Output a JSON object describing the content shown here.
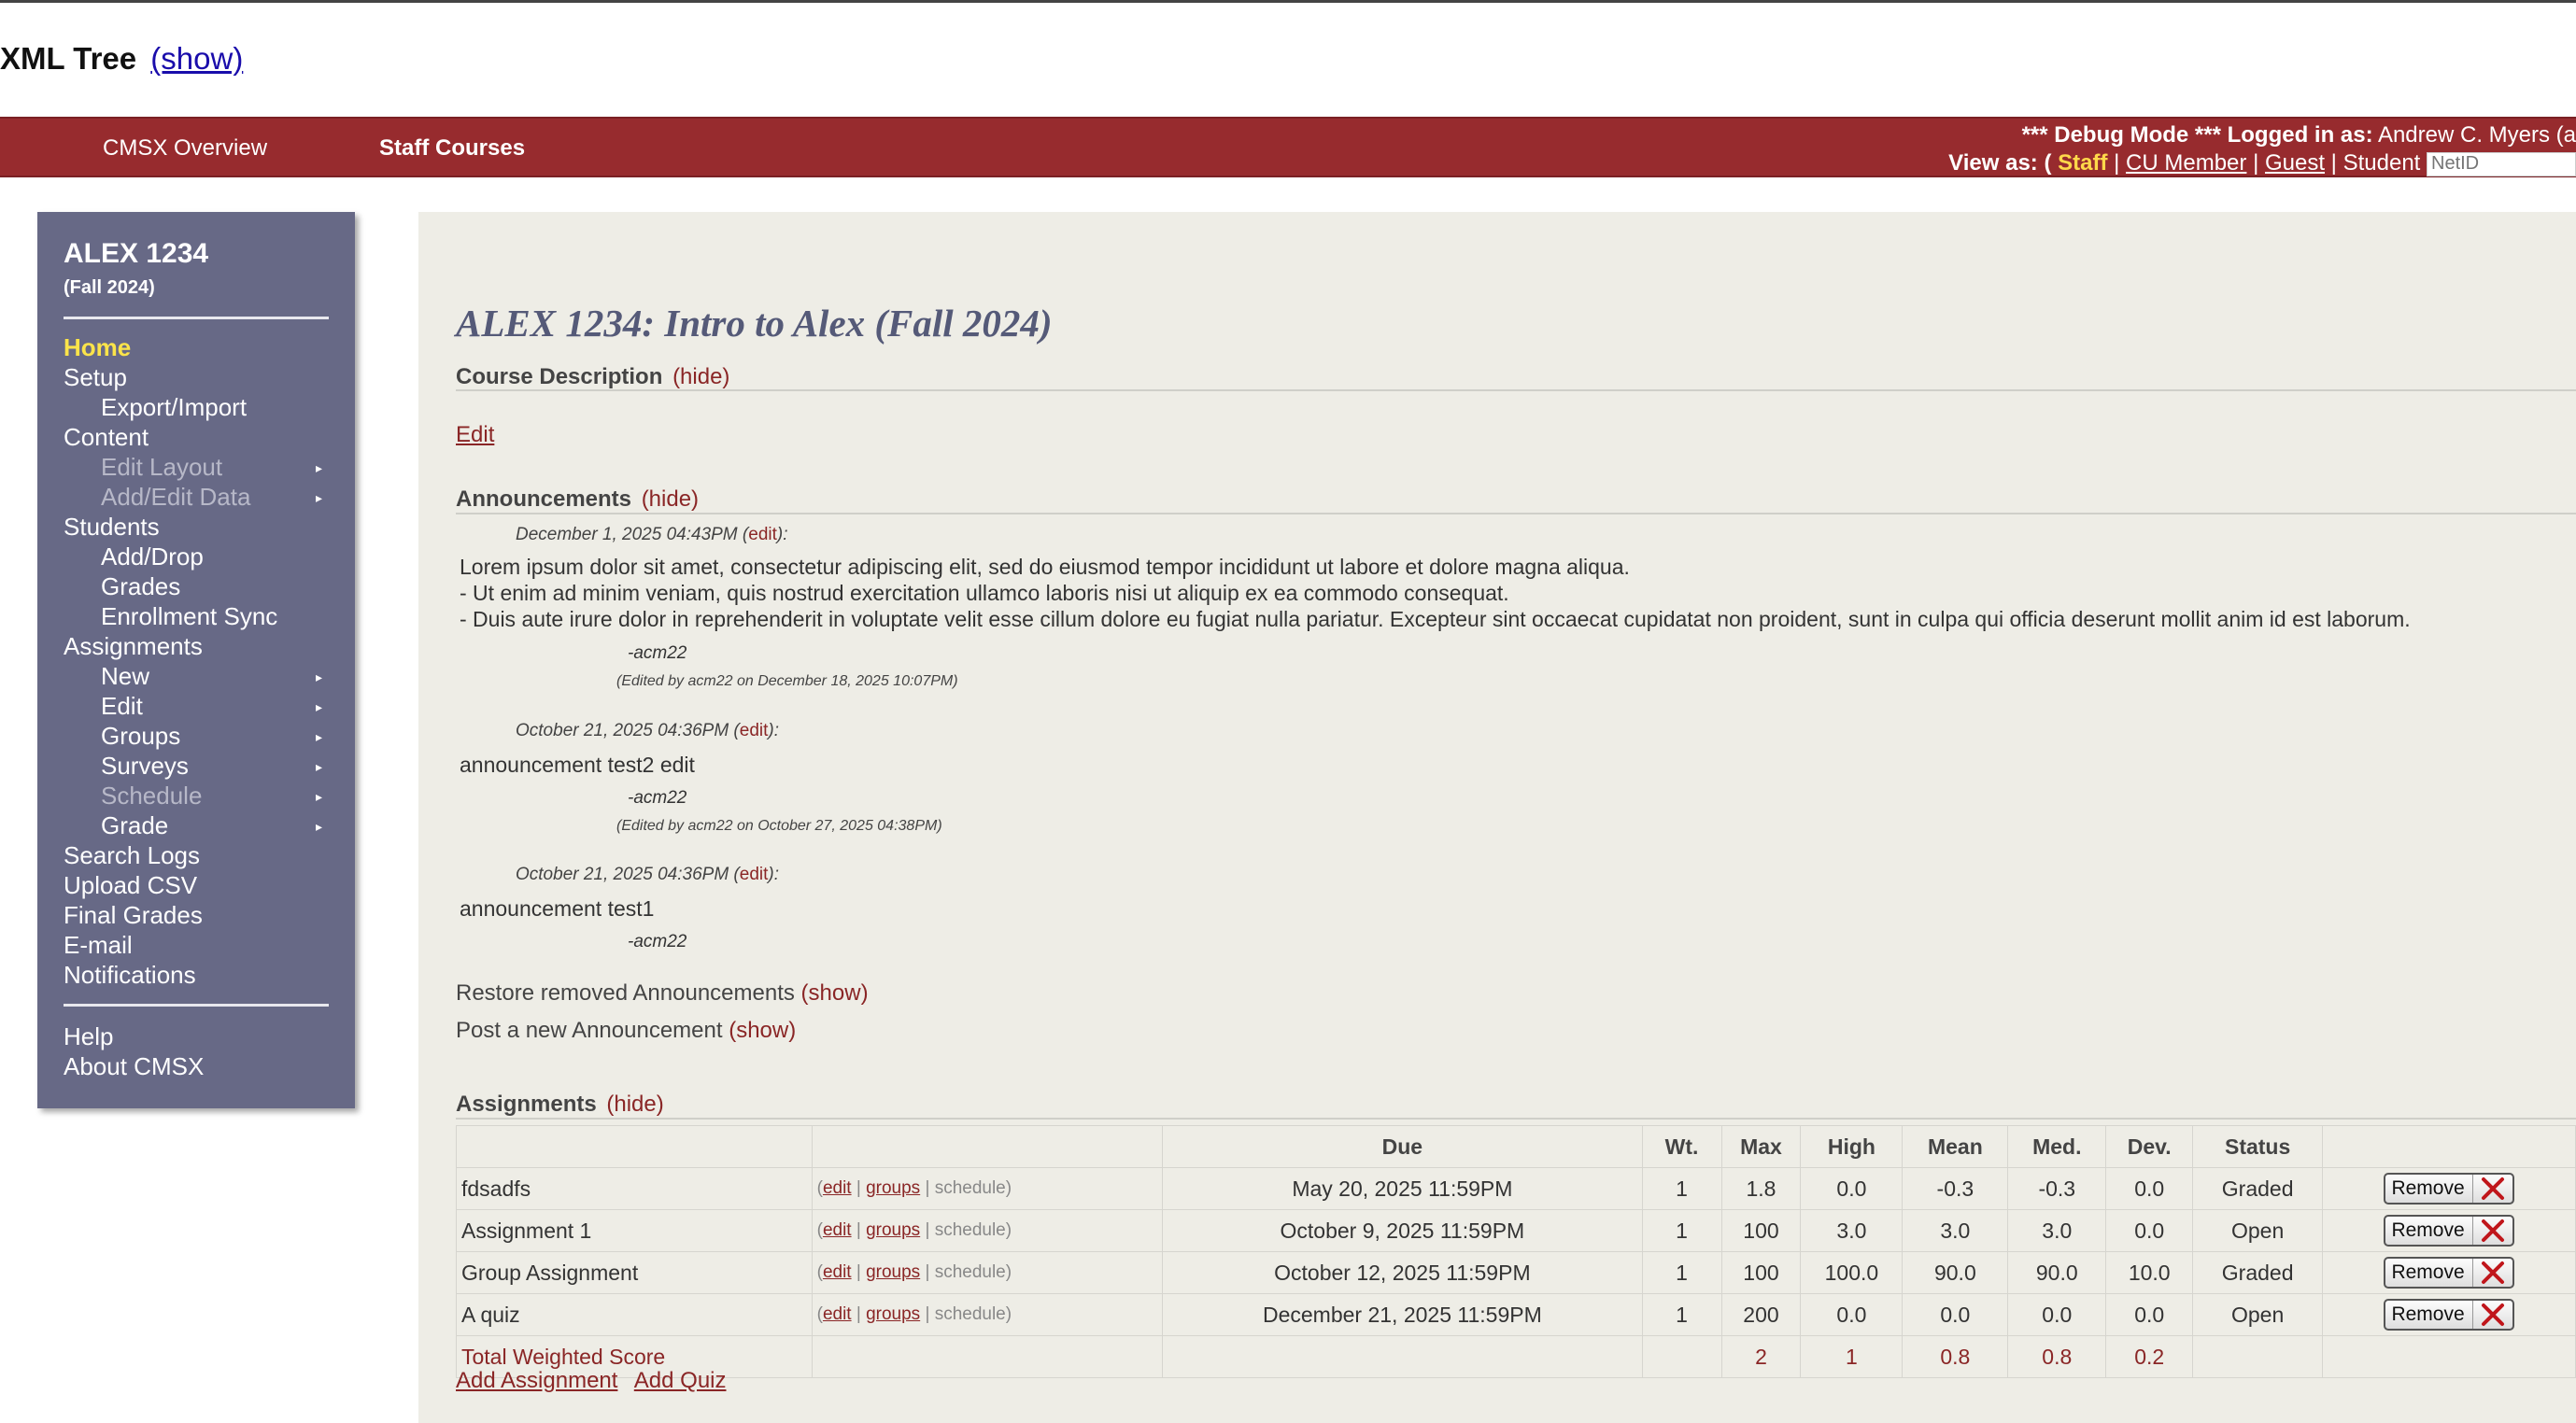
{
  "xml_tree": {
    "title": "XML Tree",
    "toggle": "(show)"
  },
  "nav": {
    "tabs": [
      "CMSX Overview",
      "Staff Courses"
    ]
  },
  "debug": {
    "line1_prefix": "*** Debug Mode *** Logged in as:",
    "user": "Andrew C. Myers (a",
    "view_as_label": "View as: (",
    "roles": [
      "Staff",
      "CU Member",
      "Guest",
      "Student"
    ],
    "netid_placeholder": "NetID"
  },
  "sidebar": {
    "course_code": "ALEX 1234",
    "term": "(Fall 2024)",
    "items": [
      {
        "label": "Home"
      },
      {
        "label": "Setup"
      },
      {
        "label": "Export/Import"
      },
      {
        "label": "Content"
      },
      {
        "label": "Edit Layout"
      },
      {
        "label": "Add/Edit Data"
      },
      {
        "label": "Students"
      },
      {
        "label": "Add/Drop"
      },
      {
        "label": "Grades"
      },
      {
        "label": "Enrollment Sync"
      },
      {
        "label": "Assignments"
      },
      {
        "label": "New"
      },
      {
        "label": "Edit"
      },
      {
        "label": "Groups"
      },
      {
        "label": "Surveys"
      },
      {
        "label": "Schedule"
      },
      {
        "label": "Grade"
      },
      {
        "label": "Search Logs"
      },
      {
        "label": "Upload CSV"
      },
      {
        "label": "Final Grades"
      },
      {
        "label": "E-mail"
      },
      {
        "label": "Notifications"
      },
      {
        "label": "Help"
      },
      {
        "label": "About CMSX"
      }
    ]
  },
  "main": {
    "course_title": "ALEX 1234: Intro to Alex (Fall 2024)",
    "course_description": {
      "heading": "Course Description",
      "toggle": "(hide)",
      "edit": "Edit"
    },
    "announcements": {
      "heading": "Announcements",
      "toggle": "(hide)",
      "items": [
        {
          "date": "December 1, 2025 04:43PM",
          "edit": "edit",
          "lines": [
            "Lorem ipsum dolor sit amet, consectetur adipiscing elit, sed do eiusmod tempor incididunt ut labore et dolore magna aliqua.",
            "- Ut enim ad minim veniam, quis nostrud exercitation ullamco laboris nisi ut aliquip ex ea commodo consequat.",
            "- Duis aute irure dolor in reprehenderit in voluptate velit esse cillum dolore eu fugiat nulla pariatur. Excepteur sint occaecat cupidatat non proident, sunt in culpa qui officia deserunt mollit anim id est laborum."
          ],
          "signature": "-acm22",
          "edited": "(Edited by acm22 on December 18, 2025 10:07PM)"
        },
        {
          "date": "October 21, 2025 04:36PM",
          "edit": "edit",
          "lines": [
            "announcement test2 edit"
          ],
          "signature": "-acm22",
          "edited": "(Edited by acm22 on October 27, 2025 04:38PM)"
        },
        {
          "date": "October 21, 2025 04:36PM",
          "edit": "edit",
          "lines": [
            "announcement test1"
          ],
          "signature": "-acm22",
          "edited": ""
        }
      ],
      "restore_label": "Restore removed Announcements",
      "post_label": "Post a new Announcement",
      "show_toggle": "(show)"
    },
    "assignments": {
      "heading": "Assignments",
      "toggle": "(hide)",
      "columns": [
        "",
        "",
        "Due",
        "Wt.",
        "Max",
        "High",
        "Mean",
        "Med.",
        "Dev.",
        "Status",
        ""
      ],
      "action_labels": [
        "edit",
        "groups",
        "schedule"
      ],
      "remove_label": "Remove",
      "rows": [
        {
          "name": "fdsadfs",
          "due": "May 20, 2025 11:59PM",
          "wt": "1",
          "max": "1.8",
          "high": "0.0",
          "mean": "-0.3",
          "med": "-0.3",
          "dev": "0.0",
          "status": "Graded"
        },
        {
          "name": "Assignment 1",
          "due": "October 9, 2025 11:59PM",
          "wt": "1",
          "max": "100",
          "high": "3.0",
          "mean": "3.0",
          "med": "3.0",
          "dev": "0.0",
          "status": "Open"
        },
        {
          "name": "Group Assignment",
          "due": "October 12, 2025 11:59PM",
          "wt": "1",
          "max": "100",
          "high": "100.0",
          "mean": "90.0",
          "med": "90.0",
          "dev": "10.0",
          "status": "Graded"
        },
        {
          "name": "A quiz",
          "due": "December 21, 2025 11:59PM",
          "wt": "1",
          "max": "200",
          "high": "0.0",
          "mean": "0.0",
          "med": "0.0",
          "dev": "0.0",
          "status": "Open"
        }
      ],
      "total": {
        "label": "Total Weighted Score",
        "max": "2",
        "high": "1",
        "mean": "0.8",
        "med": "0.8",
        "dev": "0.2"
      },
      "add_assignment": "Add Assignment",
      "add_quiz": "Add Quiz"
    }
  }
}
